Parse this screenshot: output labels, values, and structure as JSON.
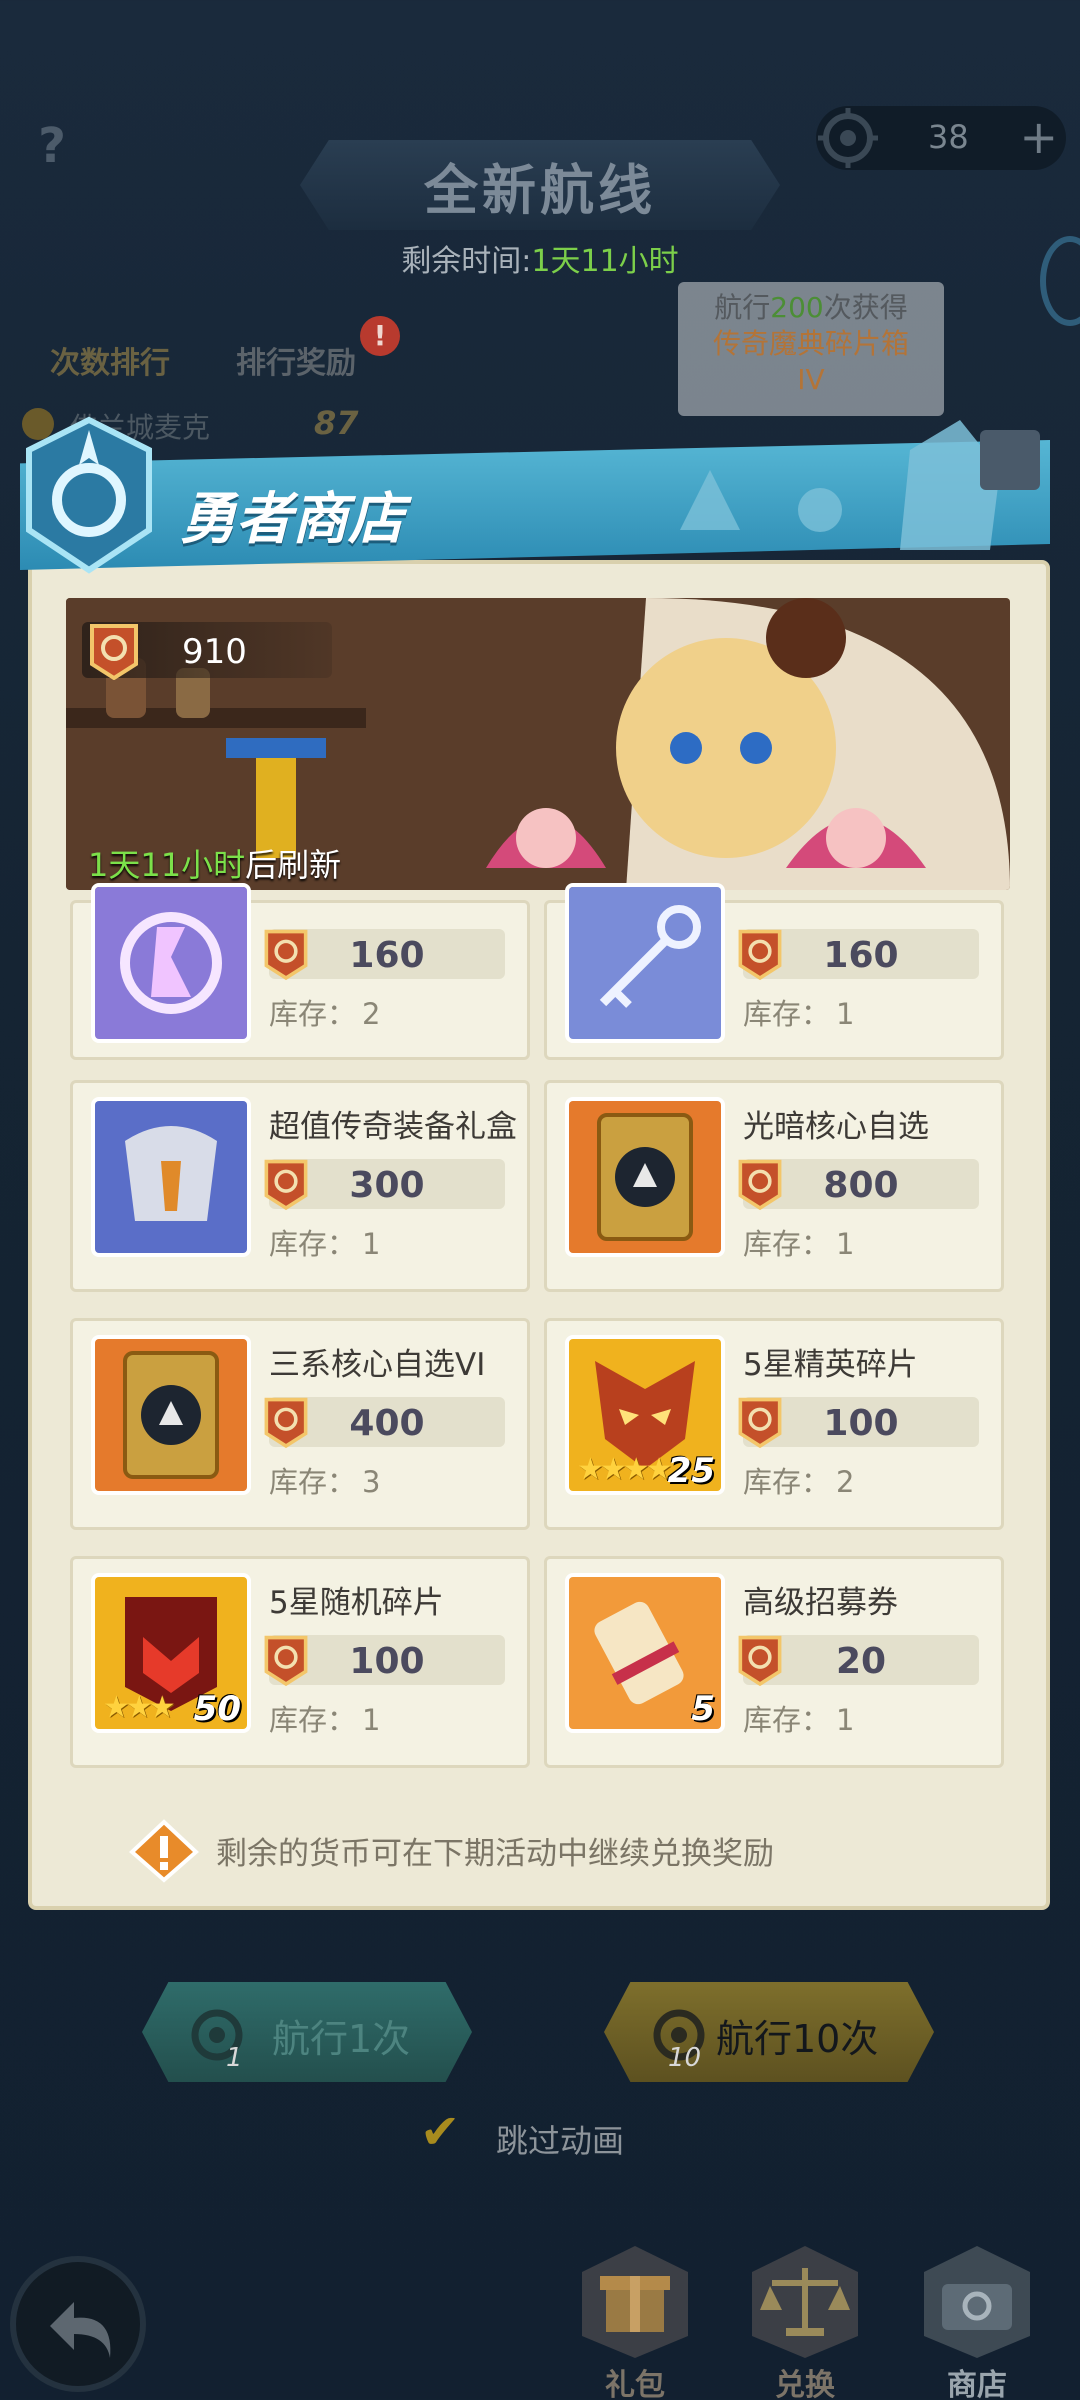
{
  "header": {
    "help_symbol": "?",
    "title": "全新航线",
    "remaining_label": "剩余时间:",
    "remaining_value": "1天11小时",
    "compass_count": "38",
    "plus_symbol": "+"
  },
  "ranking": {
    "tab_count_rank": "次数排行",
    "tab_rank_rewards": "排行奖励",
    "alert": "!",
    "first_rank_name": "佛兰城麦克",
    "first_rank_score": "87"
  },
  "voyage_tip": {
    "prefix": "航行",
    "count": "200",
    "suffix": "次获得",
    "reward_line1": "传奇魔典碎片箱",
    "reward_line2": "IV"
  },
  "shop": {
    "title": "勇者商店",
    "currency_amount": "910",
    "refresh_time": "1天11小时",
    "refresh_suffix": "后刷新",
    "stock_label": "库存：",
    "items": [
      {
        "name": "",
        "price": "160",
        "stock": "2",
        "icon": "rune-icon"
      },
      {
        "name": "",
        "price": "160",
        "stock": "1",
        "icon": "key-icon"
      },
      {
        "name": "超值传奇装备礼盒",
        "price": "300",
        "stock": "1",
        "icon": "armor-icon"
      },
      {
        "name": "光暗核心自选",
        "price": "800",
        "stock": "1",
        "icon": "core-card-icon"
      },
      {
        "name": "三系核心自选VI",
        "price": "400",
        "stock": "3",
        "icon": "core-card-icon"
      },
      {
        "name": "5星精英碎片",
        "price": "100",
        "stock": "2",
        "icon": "elite-mask-icon",
        "qty": "25",
        "stars": "★★★★"
      },
      {
        "name": "5星随机碎片",
        "price": "100",
        "stock": "1",
        "icon": "random-shard-icon",
        "qty": "50",
        "stars": "★★★"
      },
      {
        "name": "高级招募券",
        "price": "20",
        "stock": "1",
        "icon": "scroll-icon",
        "qty": "5"
      }
    ],
    "notice": "剩余的货币可在下期活动中继续兑换奖励"
  },
  "actions": {
    "sail_once": "航行1次",
    "sail_once_badge": "1",
    "sail_ten": "航行10次",
    "sail_ten_badge": "10",
    "skip_animation": "跳过动画"
  },
  "bottom_nav": {
    "gift": "礼包",
    "exchange": "兑换",
    "shop": "商店"
  },
  "colors": {
    "accent_green": "#7ccf4a",
    "shop_header": "#2c8bb3",
    "price_text": "#4b4a5e"
  }
}
